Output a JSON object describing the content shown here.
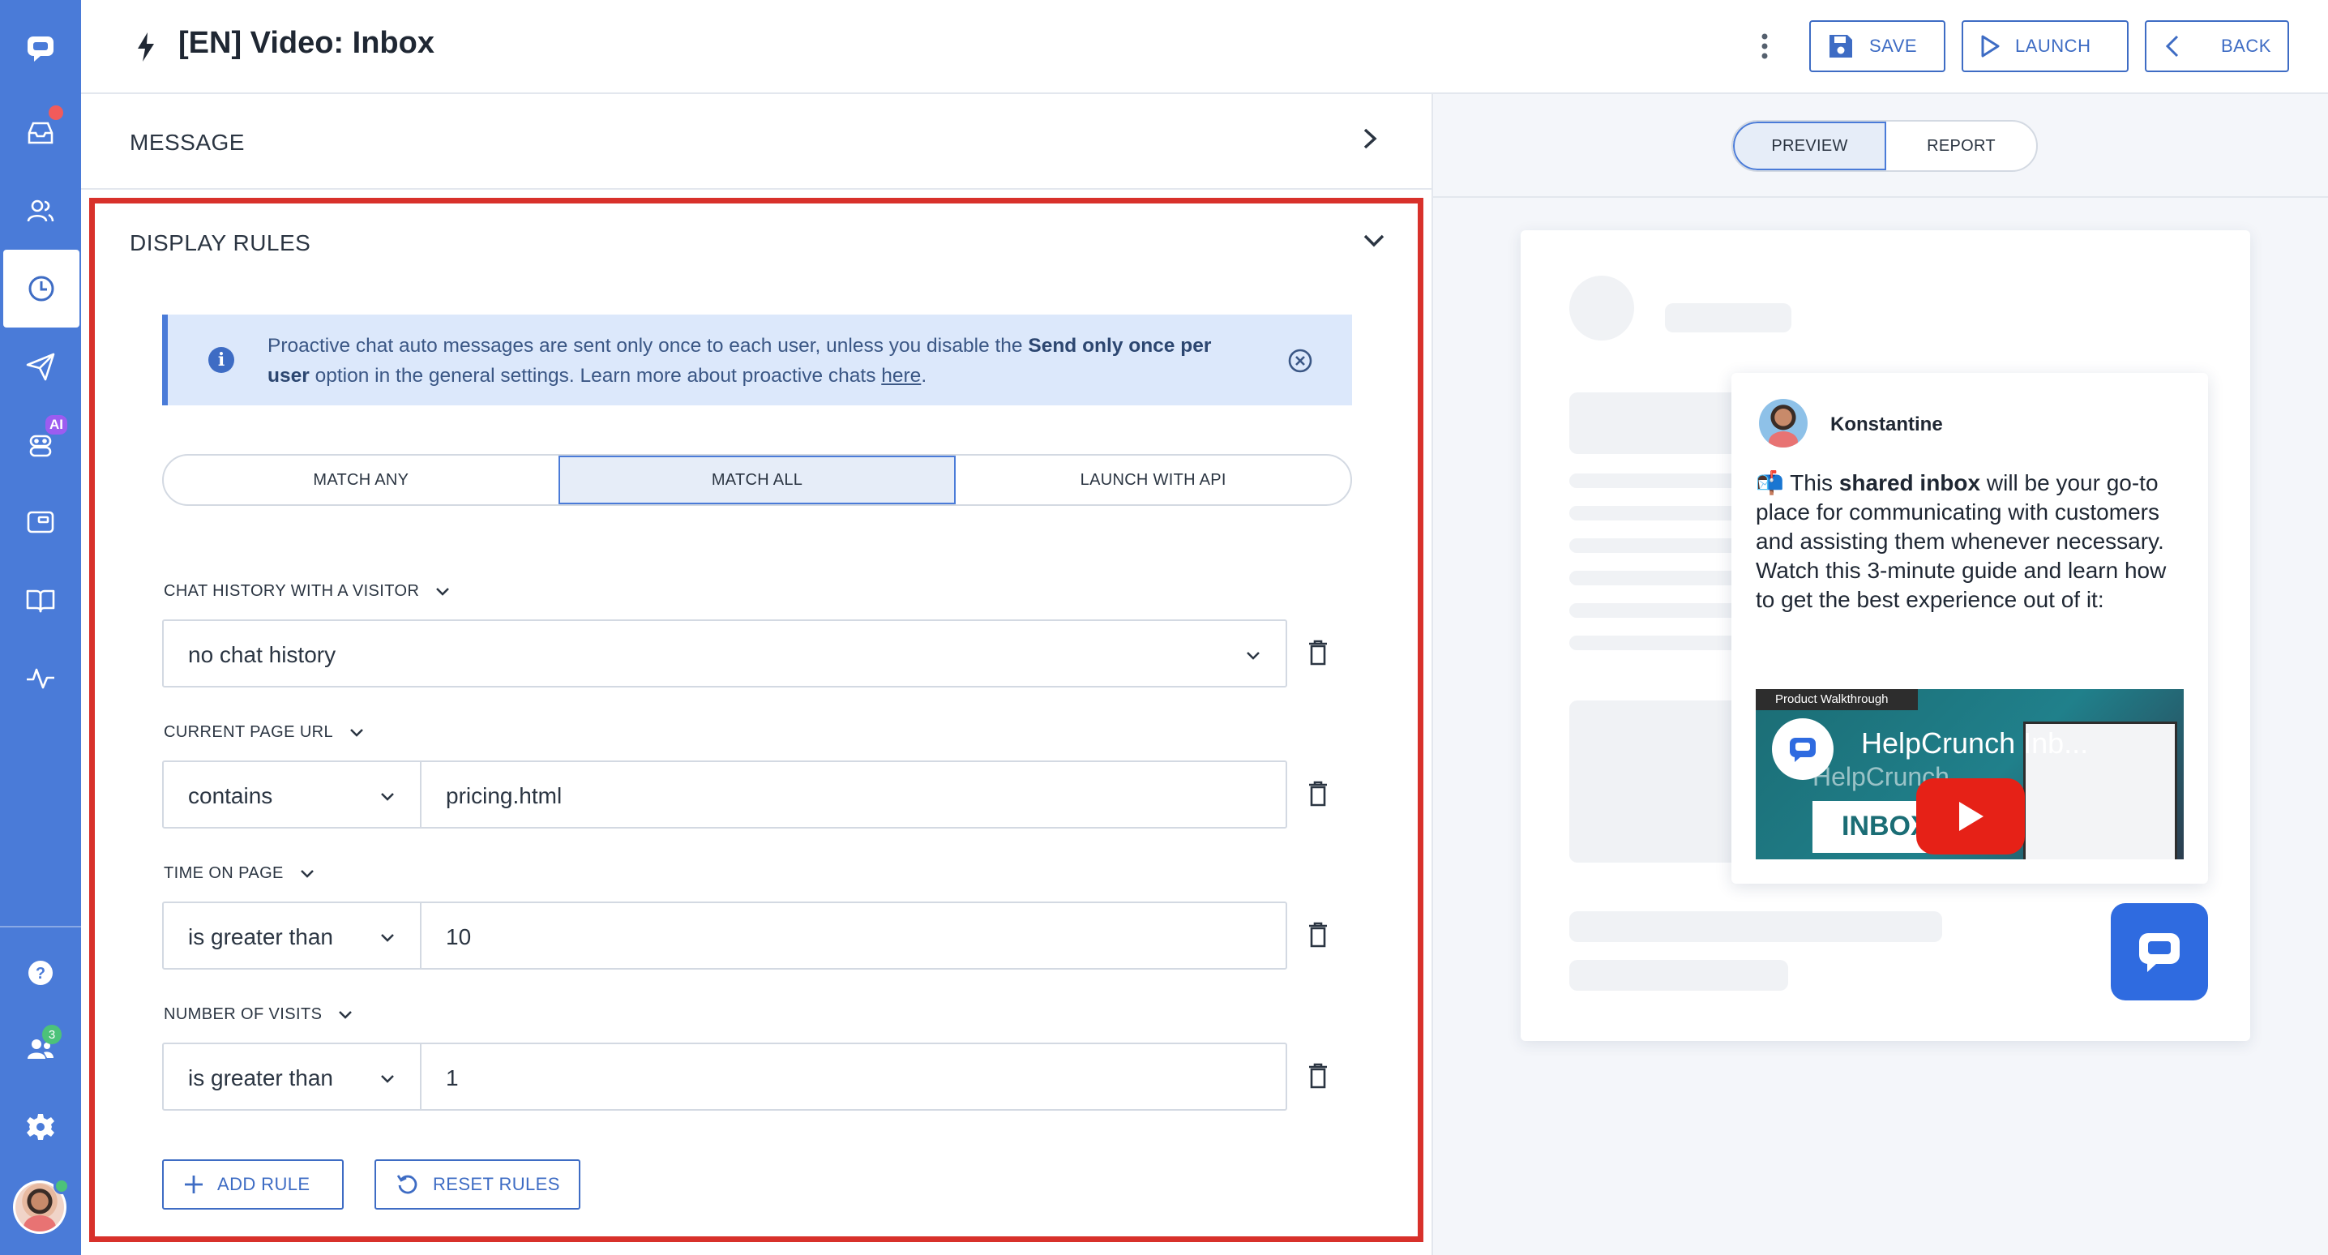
{
  "header": {
    "title": "[EN] Video: Inbox",
    "save_label": "SAVE",
    "launch_label": "LAUNCH",
    "back_label": "BACK"
  },
  "sidebar": {
    "items": [
      {
        "icon": "logo-chat-icon"
      },
      {
        "icon": "inbox-icon",
        "badge": "dot"
      },
      {
        "icon": "contacts-icon"
      },
      {
        "icon": "auto-messages-clock-icon",
        "active": true
      },
      {
        "icon": "send-icon"
      },
      {
        "icon": "ai-bot-icon",
        "badge": "AI"
      },
      {
        "icon": "widget-icon"
      },
      {
        "icon": "knowledge-base-book-icon"
      },
      {
        "icon": "activity-icon"
      },
      {
        "icon": "help-icon"
      },
      {
        "icon": "team-icon",
        "badge": "3"
      },
      {
        "icon": "settings-gear-icon"
      },
      {
        "icon": "user-avatar"
      }
    ],
    "ai_badge": "AI",
    "team_badge": "3"
  },
  "panels": {
    "message_label": "MESSAGE",
    "display_rules_label": "DISPLAY RULES"
  },
  "info": {
    "text_before": "Proactive chat auto messages are sent only once to each user, unless you disable the ",
    "bold": "Send only once per user",
    "text_after": " option in the general settings. Learn more about proactive chats ",
    "link": "here",
    "end": "."
  },
  "match": {
    "options": [
      "MATCH ANY",
      "MATCH ALL",
      "LAUNCH WITH API"
    ],
    "selected": "MATCH ALL"
  },
  "rules": [
    {
      "label": "CHAT HISTORY WITH A VISITOR",
      "value": "no chat history"
    },
    {
      "label": "CURRENT PAGE URL",
      "condition": "contains",
      "value": "pricing.html"
    },
    {
      "label": "TIME ON PAGE",
      "condition": "is greater than",
      "value": "10"
    },
    {
      "label": "NUMBER OF VISITS",
      "condition": "is greater than",
      "value": "1"
    }
  ],
  "footer": {
    "add_rule": "ADD RULE",
    "reset_rules": "RESET RULES"
  },
  "preview": {
    "tabs": [
      "PREVIEW",
      "REPORT"
    ],
    "active_tab": "PREVIEW",
    "agent_name": "Konstantine",
    "emoji": "📬",
    "msg_before": " This ",
    "msg_bold": "shared inbox",
    "msg_after": " will be your go-to place for communicating with customers and assisting them whenever necessary. Watch this 3-minute guide and learn how to get the best experience out of it:",
    "video_tag": "Product Walkthrough",
    "video_title": "HelpCrunch Inb...",
    "video_sub": "HelpCrunch",
    "video_inbox": "INBOX"
  },
  "colors": {
    "sidebar": "#4a7bd8",
    "accent": "#3e6cc4",
    "highlight": "#d8312b",
    "info_bg": "#dce8fb"
  }
}
